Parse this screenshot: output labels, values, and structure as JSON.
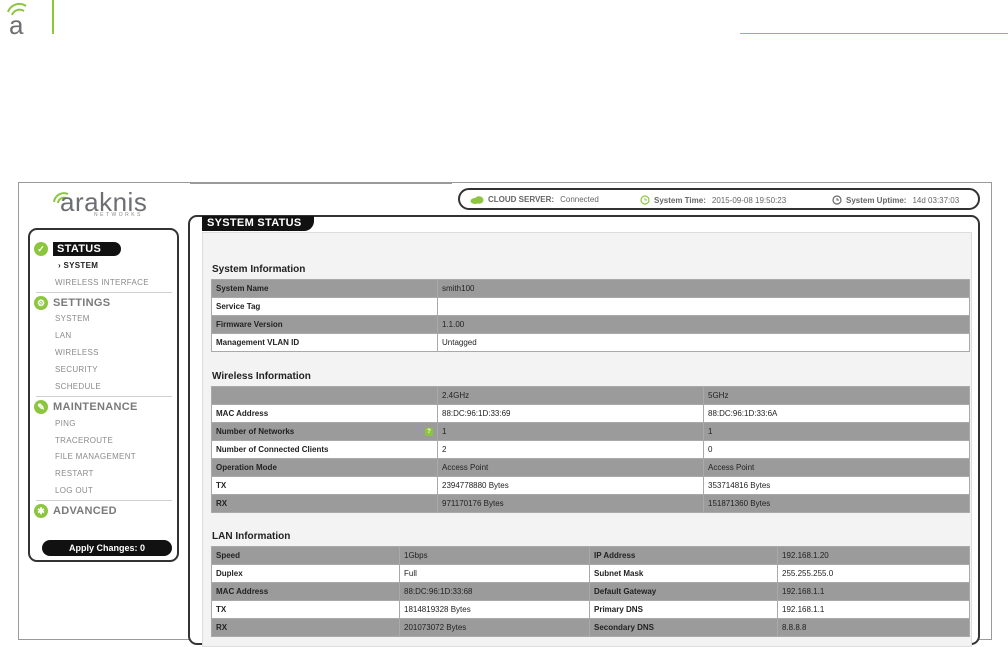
{
  "header": {
    "logo_glyph": "a"
  },
  "brand": {
    "name": "araknis",
    "sub": "NETWORKS"
  },
  "status_bar": {
    "cloud_label": "CLOUD SERVER:",
    "cloud_value": "Connected",
    "time_label": "System Time:",
    "time_value": "2015-09-08 19:50:23",
    "uptime_label": "System Uptime:",
    "uptime_value": "14d 03:37:03"
  },
  "sidebar": {
    "status": "STATUS",
    "status_items": [
      "SYSTEM",
      "WIRELESS INTERFACE"
    ],
    "settings": "SETTINGS",
    "settings_items": [
      "SYSTEM",
      "LAN",
      "WIRELESS",
      "SECURITY",
      "SCHEDULE"
    ],
    "maintenance": "MAINTENANCE",
    "maintenance_items": [
      "PING",
      "TRACEROUTE",
      "FILE MANAGEMENT",
      "RESTART",
      "LOG OUT"
    ],
    "advanced": "ADVANCED",
    "apply": "Apply Changes: 0"
  },
  "panel": {
    "title": "SYSTEM STATUS",
    "system_info": {
      "title": "System Information",
      "rows": [
        [
          "System Name",
          "smith100"
        ],
        [
          "Service Tag",
          ""
        ],
        [
          "Firmware Version",
          "1.1.00"
        ],
        [
          "Management VLAN ID",
          "Untagged"
        ]
      ]
    },
    "wireless_info": {
      "title": "Wireless Information",
      "header": [
        "",
        "2.4GHz",
        "5GHz"
      ],
      "rows": [
        [
          "MAC Address",
          "88:DC:96:1D:33:69",
          "88:DC:96:1D:33:6A"
        ],
        [
          "Number of Networks",
          "1",
          "1"
        ],
        [
          "Number of Connected Clients",
          "2",
          "0"
        ],
        [
          "Operation Mode",
          "Access Point",
          "Access Point"
        ],
        [
          "TX",
          "2394778880 Bytes",
          "353714816 Bytes"
        ],
        [
          "RX",
          "971170176 Bytes",
          "151871360 Bytes"
        ]
      ]
    },
    "lan_info": {
      "title": "LAN Information",
      "rows": [
        [
          "Speed",
          "1Gbps",
          "IP Address",
          "192.168.1.20"
        ],
        [
          "Duplex",
          "Full",
          "Subnet Mask",
          "255.255.255.0"
        ],
        [
          "MAC Address",
          "88:DC:96:1D:33:68",
          "Default Gateway",
          "192.168.1.1"
        ],
        [
          "TX",
          "1814819328 Bytes",
          "Primary DNS",
          "192.168.1.1"
        ],
        [
          "RX",
          "201073072 Bytes",
          "Secondary DNS",
          "8.8.8.8"
        ]
      ]
    }
  }
}
